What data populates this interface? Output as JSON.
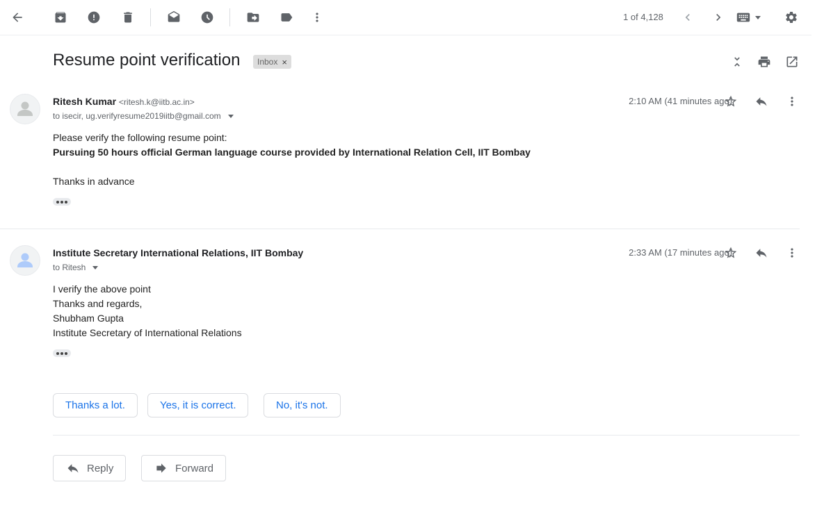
{
  "toolbar": {
    "icons": [
      "back-arrow-icon",
      "archive-icon",
      "report-spam-icon",
      "delete-icon",
      "mark-unread-icon",
      "snooze-icon",
      "move-to-icon",
      "label-icon",
      "more-vert-icon"
    ],
    "pager_text": "1 of 4,128",
    "older_icon": "chevron-left-icon",
    "newer_icon": "chevron-right-icon",
    "input_tools_icon": "keyboard-icon",
    "settings_icon": "gear-icon"
  },
  "thread": {
    "subject": "Resume point verification",
    "label": "Inbox",
    "label_close": "×"
  },
  "messages": [
    {
      "sender_name": "Ritesh Kumar",
      "sender_email": "<ritesh.k@iitb.ac.in>",
      "recipients": "to isecir, ug.verifyresume2019iitb@gmail.com",
      "time": "2:10 AM (41 minutes ago)",
      "lines": [
        "Please verify the following resume point:",
        "Pursuing 50 hours official German language course provided by International Relation Cell, IIT Bombay",
        "Thanks in advance"
      ]
    },
    {
      "sender_name": "Institute Secretary International Relations, IIT Bombay",
      "recipients": "to Ritesh",
      "time": "2:33 AM (17 minutes ago)",
      "lines": [
        "I verify the above point",
        "Thanks and regards,",
        "Shubham Gupta",
        "Institute Secretary of International Relations"
      ]
    }
  ],
  "smart_replies": [
    "Thanks a lot.",
    "Yes, it is correct.",
    "No, it's not."
  ],
  "actions": {
    "reply_label": "Reply",
    "forward_label": "Forward"
  },
  "colors": {
    "accent": "#1a73e8",
    "icon": "#5f6368",
    "label_chip_bg": "#dddddd"
  }
}
